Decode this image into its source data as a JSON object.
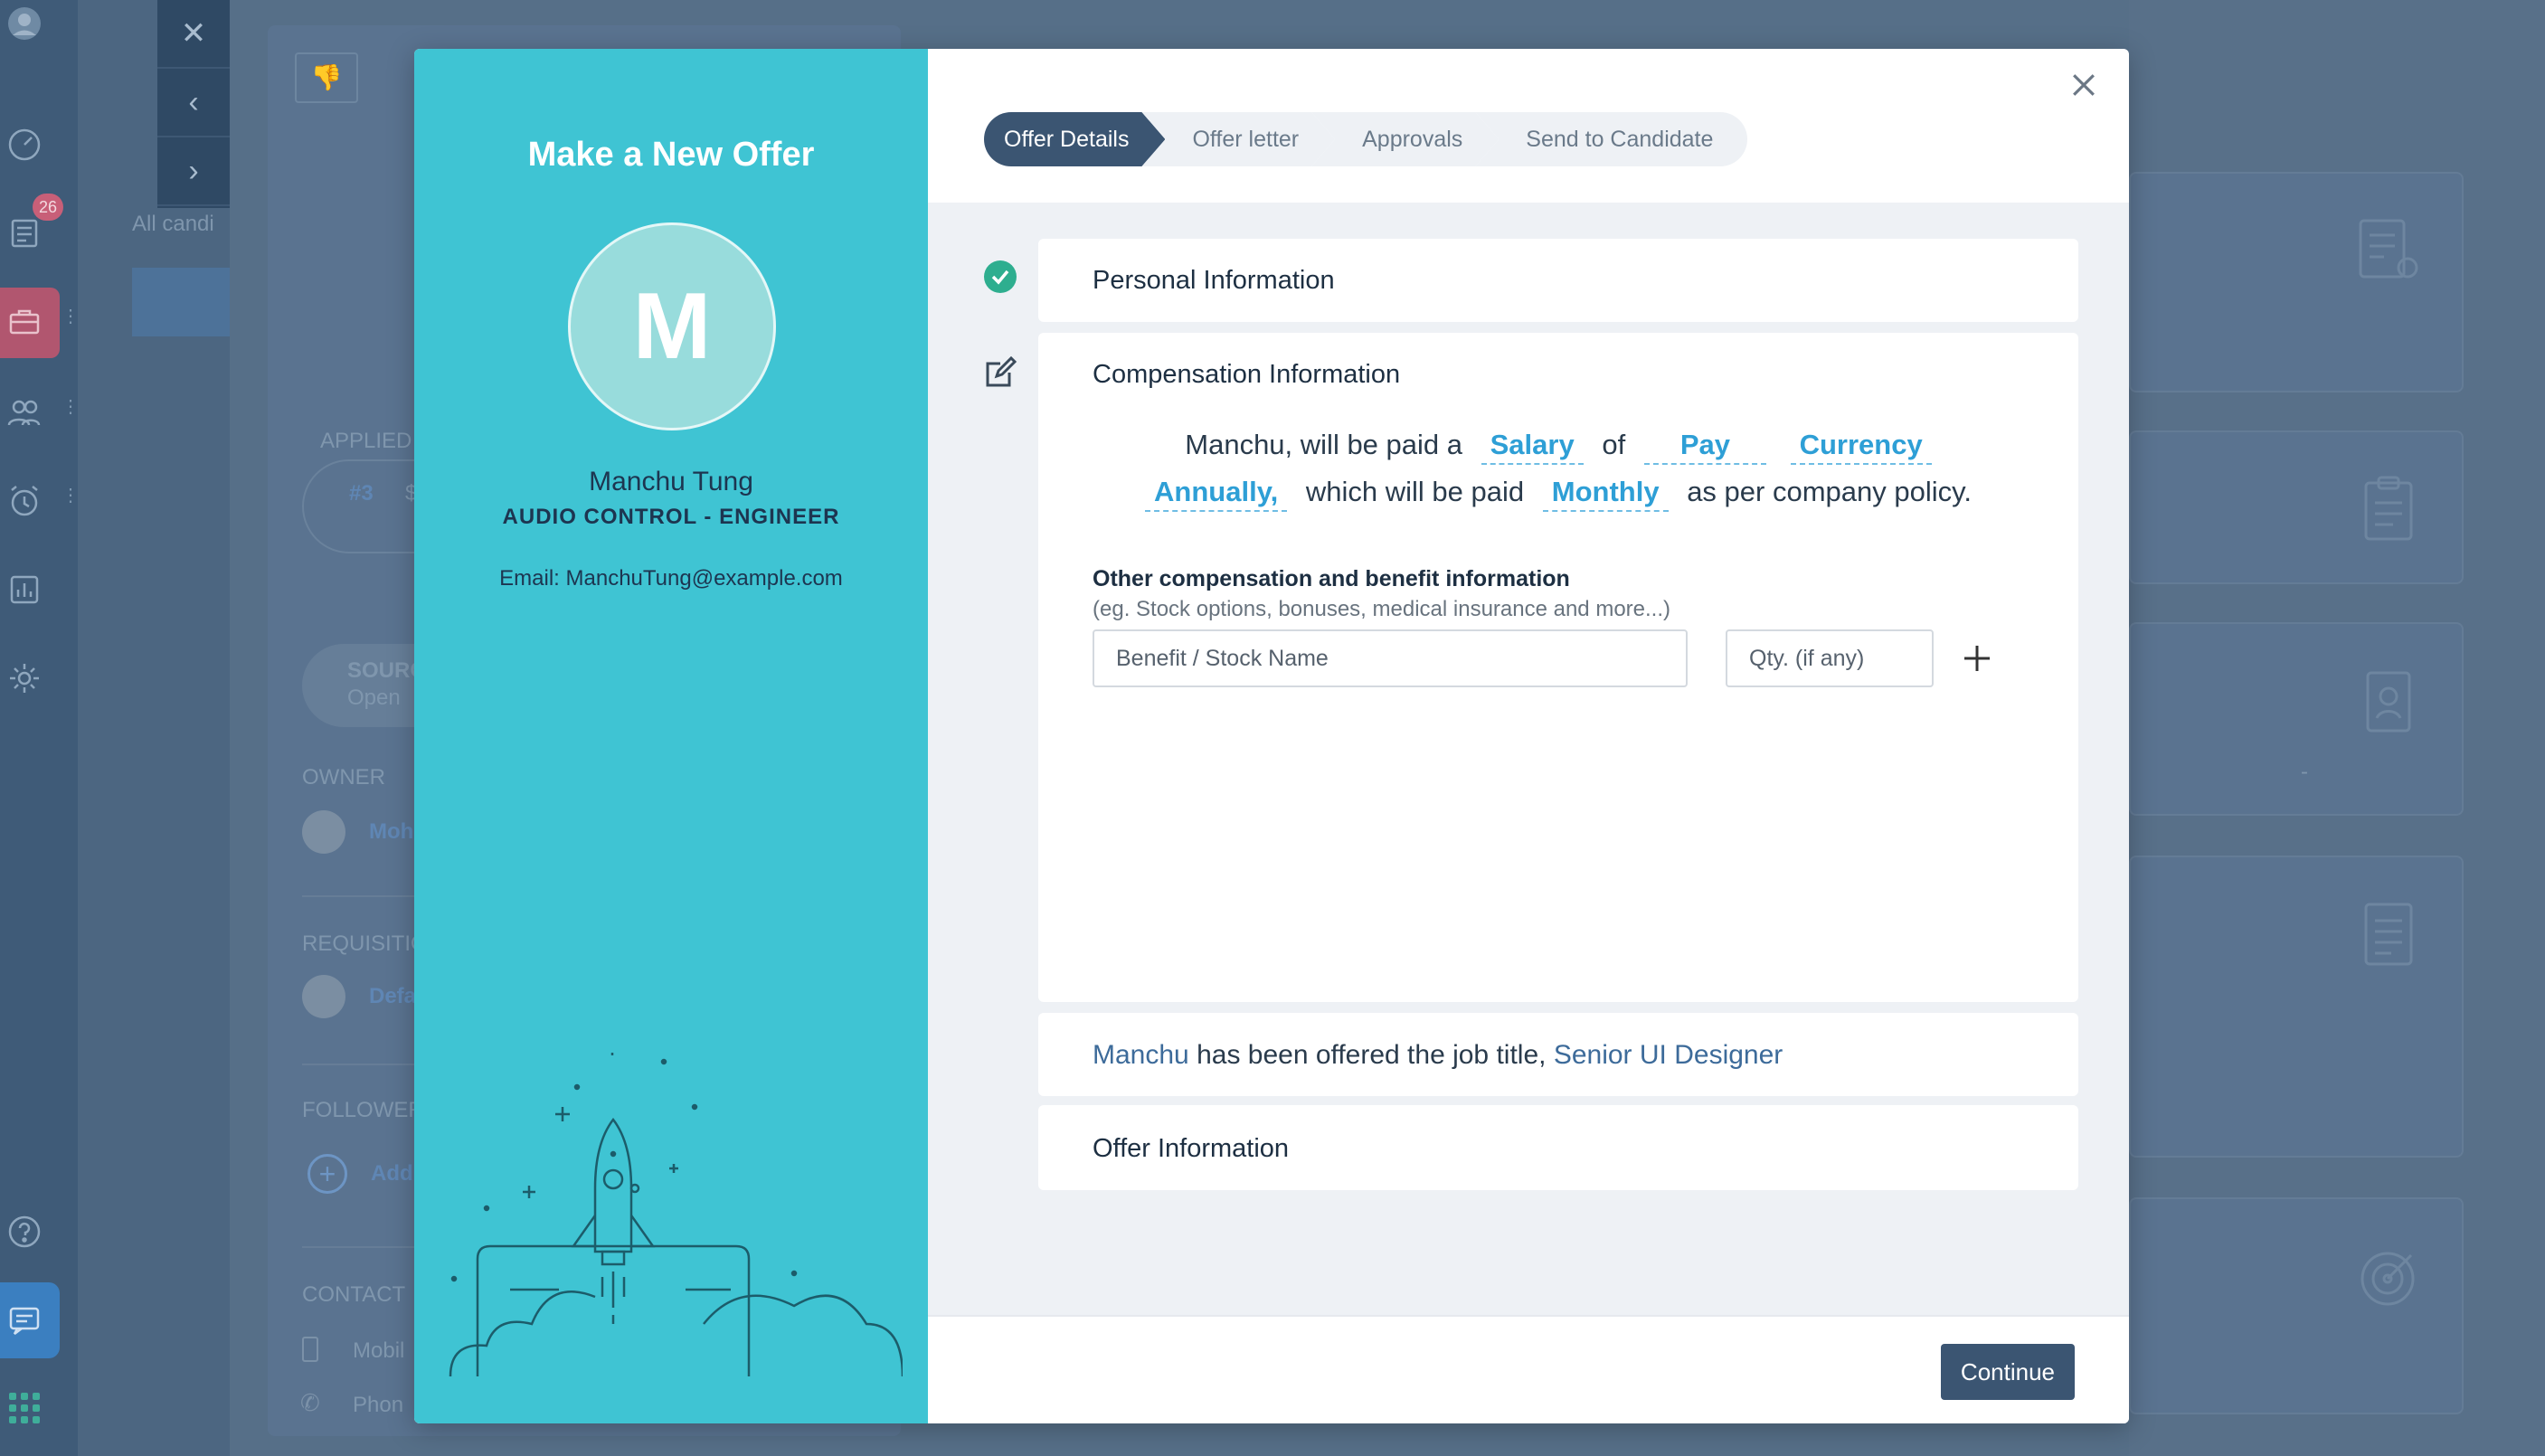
{
  "modal": {
    "title": "Make a New Offer",
    "candidate": {
      "initial": "M",
      "name": "Manchu Tung",
      "role": "AUDIO CONTROL - ENGINEER",
      "email": "Email: ManchuTung@example.com"
    },
    "steps": [
      "Offer Details",
      "Offer letter",
      "Approvals",
      "Send to Candidate"
    ],
    "active_step": "Offer Details",
    "sections": {
      "personal": "Personal Information",
      "compensation": {
        "title": "Compensation Information",
        "text_1": "Manchu, will be paid a",
        "salary": "Salary",
        "text_of": "of",
        "pay": "Pay",
        "currency": "Currency",
        "annually": "Annually,",
        "text_2": "which will be paid",
        "monthly": "Monthly",
        "text_3": "as per company policy.",
        "other_title": "Other compensation and benefit information",
        "other_subtitle": "(eg. Stock options, bonuses, medical insurance and more...)",
        "benefit_placeholder": "Benefit / Stock Name",
        "qty_placeholder": "Qty. (if any)"
      },
      "job": {
        "name": "Manchu",
        "text": "has been offered the job title,",
        "title": "Senior UI Designer"
      },
      "offer": "Offer Information"
    },
    "continue_label": "Continue"
  },
  "background": {
    "badge_count": "26",
    "all_candidates": "All candi",
    "applied": "APPLIED",
    "applied_number": "#3",
    "applied_extra": "$",
    "source_label": "SOURC",
    "source_value": "Open",
    "owner_label": "OWNER",
    "owner_name": "Moh",
    "requisition_label": "REQUISITIO",
    "requisition_value": "Defa",
    "followers_label": "FOLLOWER",
    "followers_add": "Add",
    "contact_label": "CONTACT",
    "contact_mobile": "Mobil",
    "contact_phone": "Phon",
    "right_dash": "-"
  },
  "colors": {
    "accent_teal": "#3fc4d3",
    "navy": "#3b5572",
    "link_blue": "#2e9fd6",
    "success_green": "#2eae8f"
  }
}
